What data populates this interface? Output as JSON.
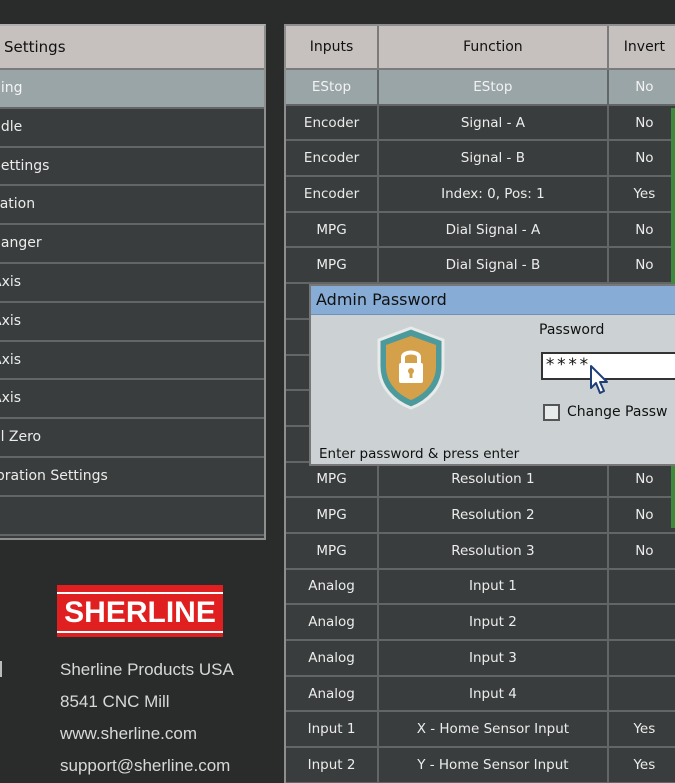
{
  "left_panel": {
    "header": "Settings",
    "items": [
      {
        "label": "hing",
        "selected": true
      },
      {
        "label": "ndle",
        "selected": false
      },
      {
        "label": "Settings",
        "selected": false
      },
      {
        "label": "cation",
        "selected": false
      },
      {
        "label": "hanger",
        "selected": false
      },
      {
        "label": "Axis",
        "selected": false
      },
      {
        "label": "Axis",
        "selected": false
      },
      {
        "label": "Axis",
        "selected": false
      },
      {
        "label": "Axis",
        "selected": false
      },
      {
        "label": "ol Zero",
        "selected": false
      },
      {
        "label": "ibration Settings",
        "selected": false
      },
      {
        "label": "",
        "selected": false
      }
    ]
  },
  "branding": {
    "logo": "SHERLINE",
    "company": "Sherline Products USA",
    "machine": "8541 CNC Mill",
    "website": "www.sherline.com",
    "email": "support@sherline.com",
    "logo_color": "#e02020"
  },
  "table": {
    "headers": [
      "Inputs",
      "Function",
      "Invert"
    ],
    "rows": [
      {
        "input": "EStop",
        "function": "EStop",
        "invert": "No",
        "selected": true
      },
      {
        "input": "Encoder",
        "function": "Signal - A",
        "invert": "No"
      },
      {
        "input": "Encoder",
        "function": "Signal - B",
        "invert": "No"
      },
      {
        "input": "Encoder",
        "function": "Index: 0, Pos: 1",
        "invert": "Yes"
      },
      {
        "input": "MPG",
        "function": "Dial Signal - A",
        "invert": "No"
      },
      {
        "input": "MPG",
        "function": "Dial Signal - B",
        "invert": "No"
      },
      {
        "input": "",
        "function": "",
        "invert": ""
      },
      {
        "input": "",
        "function": "",
        "invert": ""
      },
      {
        "input": "",
        "function": "",
        "invert": ""
      },
      {
        "input": "",
        "function": "",
        "invert": ""
      },
      {
        "input": "",
        "function": "",
        "invert": ""
      },
      {
        "input": "MPG",
        "function": "Resolution 1",
        "invert": "No"
      },
      {
        "input": "MPG",
        "function": "Resolution 2",
        "invert": "No"
      },
      {
        "input": "MPG",
        "function": "Resolution 3",
        "invert": "No"
      },
      {
        "input": "Analog",
        "function": "Input 1",
        "invert": ""
      },
      {
        "input": "Analog",
        "function": "Input 2",
        "invert": ""
      },
      {
        "input": "Analog",
        "function": "Input 3",
        "invert": ""
      },
      {
        "input": "Analog",
        "function": "Input 4",
        "invert": ""
      },
      {
        "input": "Input 1",
        "function": "X - Home Sensor Input",
        "invert": "Yes"
      },
      {
        "input": "Input 2",
        "function": "Y - Home Sensor Input",
        "invert": "Yes"
      }
    ]
  },
  "dialog": {
    "title": "Admin Password",
    "password_label": "Password",
    "password_value": "****",
    "checkbox_label": "Change Passw",
    "checkbox_checked": false,
    "hint": "Enter password & press enter",
    "icon": "lock-shield-icon",
    "shield_color": "#d5a04a",
    "title_bar_color": "#87acd6"
  }
}
